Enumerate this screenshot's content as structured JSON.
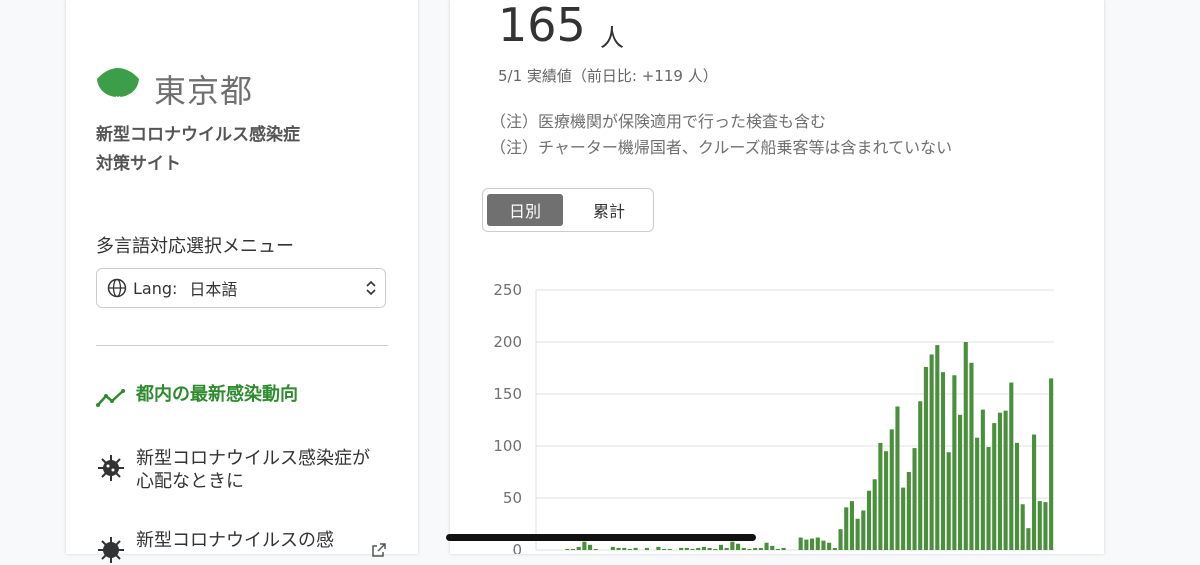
{
  "sidebar": {
    "logo_text": "東京都",
    "title_line1": "新型コロナウイルス感染症",
    "title_line2": "対策サイト",
    "lang_heading": "多言語対応選択メニュー",
    "lang_prefix": "Lang:",
    "lang_value": "日本語",
    "nav": [
      {
        "label": "都内の最新感染動向",
        "icon": "trend-line-icon",
        "active": true
      },
      {
        "label": "新型コロナウイルス感染症が心配なときに",
        "icon": "virus-icon",
        "active": false
      },
      {
        "label": "新型コロナウイルスの感",
        "icon": "virus-icon",
        "active": false
      }
    ],
    "colors": {
      "logo_green": "#3d9e4a",
      "active_green": "#2e8b2e"
    }
  },
  "card": {
    "number": "165",
    "unit": "人",
    "subtitle": "5/1 実績値（前日比: +119 人）",
    "notes": [
      "（注）医療機関が保険適用で行った検査も含む",
      "（注）チャーター機帰国者、クルーズ船乗客等は含まれていない"
    ],
    "toggle": {
      "daily": "日別",
      "cumulative": "累計",
      "selected": "日別"
    }
  },
  "chart_data": {
    "type": "bar",
    "ylim": [
      0,
      250
    ],
    "yticks": [
      0,
      50,
      100,
      150,
      200,
      250
    ],
    "bar_color": "#4a8f3c",
    "values": [
      0,
      0,
      0,
      0,
      0,
      1,
      1,
      3,
      8,
      5,
      1,
      0,
      0,
      3,
      2,
      2,
      1,
      2,
      0,
      2,
      0,
      3,
      1,
      1,
      0,
      2,
      2,
      1,
      2,
      3,
      2,
      1,
      5,
      2,
      8,
      6,
      2,
      1,
      2,
      2,
      7,
      4,
      1,
      2,
      0,
      0,
      12,
      10,
      11,
      12,
      9,
      7,
      2,
      20,
      41,
      47,
      30,
      38,
      57,
      68,
      103,
      95,
      116,
      138,
      60,
      75,
      98,
      143,
      176,
      188,
      197,
      171,
      94,
      168,
      130,
      200,
      180,
      108,
      135,
      99,
      122,
      132,
      134,
      161,
      103,
      44,
      21,
      111,
      47,
      46,
      165
    ]
  }
}
